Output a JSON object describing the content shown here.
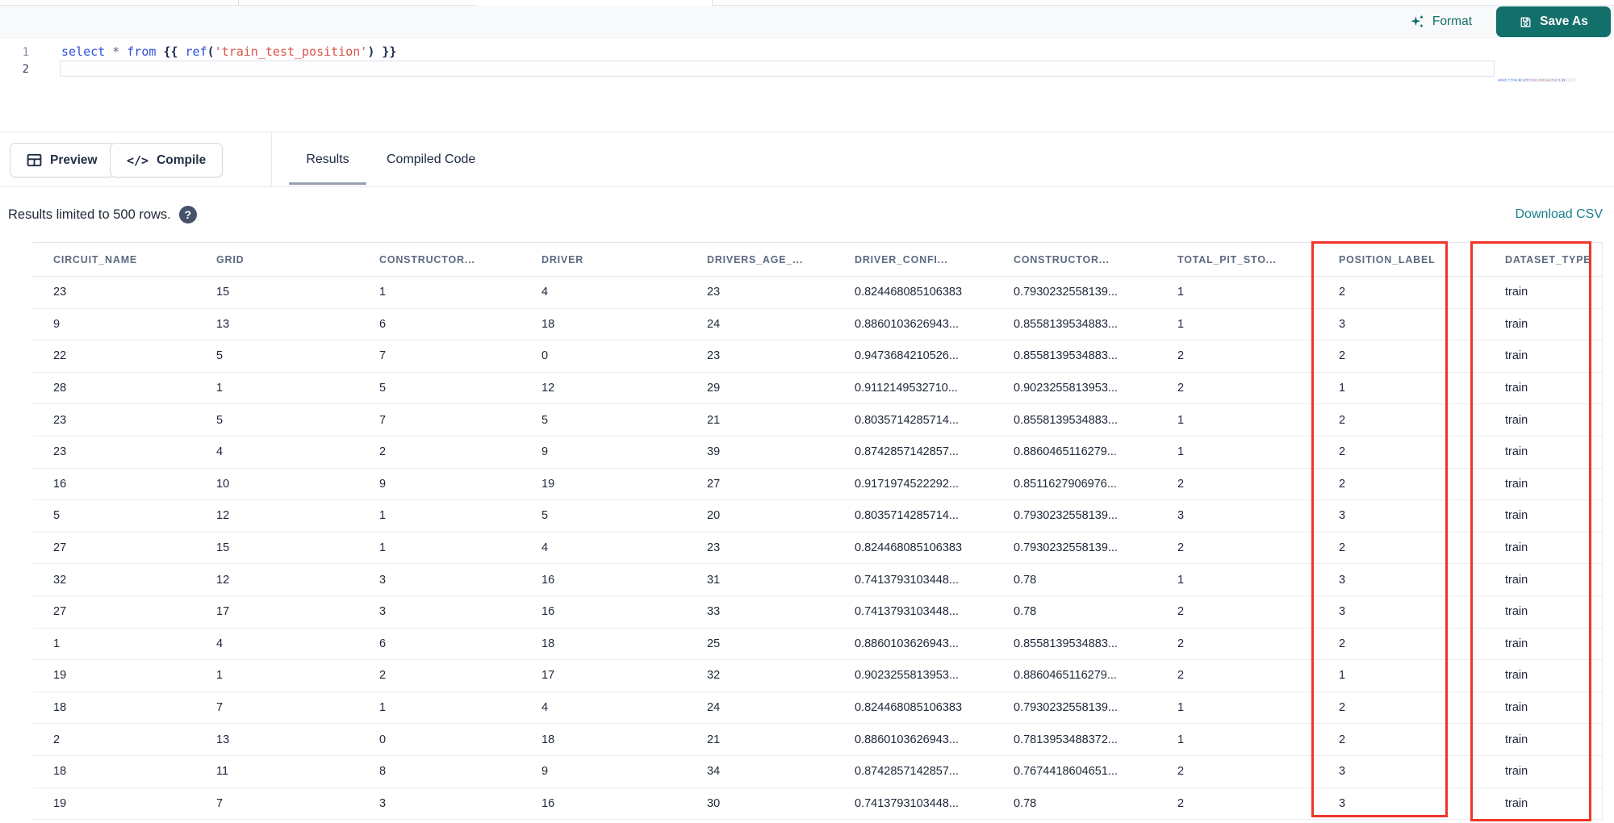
{
  "toolbar": {
    "format_label": "Format",
    "save_as_label": "Save As"
  },
  "editor": {
    "line_numbers": [
      "1",
      "2"
    ],
    "code_line_1": "select * from {{ ref('train_test_position') }}",
    "tokens": [
      {
        "t": "select",
        "c": "kw"
      },
      {
        "t": " ",
        "c": "pl"
      },
      {
        "t": "*",
        "c": "op"
      },
      {
        "t": " ",
        "c": "pl"
      },
      {
        "t": "from",
        "c": "kw"
      },
      {
        "t": " ",
        "c": "pl"
      },
      {
        "t": "{{ ",
        "c": "br"
      },
      {
        "t": "ref",
        "c": "kw"
      },
      {
        "t": "(",
        "c": "br"
      },
      {
        "t": "'train_test_position'",
        "c": "str"
      },
      {
        "t": ")",
        "c": "br"
      },
      {
        "t": " }}",
        "c": "br"
      }
    ]
  },
  "actions": {
    "preview_label": "Preview",
    "compile_label": "Compile",
    "compile_glyph": "</>"
  },
  "tabs": {
    "results": "Results",
    "compiled_code": "Compiled Code",
    "active": "Results"
  },
  "results": {
    "limit_notice": "Results limited to 500 rows.",
    "help_icon_glyph": "?",
    "download_label": "Download CSV"
  },
  "table": {
    "columns": [
      "CIRCUIT_NAME",
      "GRID",
      "CONSTRUCTOR...",
      "DRIVER",
      "DRIVERS_AGE_...",
      "DRIVER_CONFI...",
      "CONSTRUCTOR...",
      "TOTAL_PIT_STO...",
      "POSITION_LABEL",
      "DATASET_TYPE"
    ],
    "highlighted_columns": [
      "POSITION_LABEL",
      "DATASET_TYPE"
    ],
    "rows": [
      [
        "23",
        "15",
        "1",
        "4",
        "23",
        "0.824468085106383",
        "0.7930232558139...",
        "1",
        "2",
        "train"
      ],
      [
        "9",
        "13",
        "6",
        "18",
        "24",
        "0.8860103626943...",
        "0.8558139534883...",
        "1",
        "3",
        "train"
      ],
      [
        "22",
        "5",
        "7",
        "0",
        "23",
        "0.9473684210526...",
        "0.8558139534883...",
        "2",
        "2",
        "train"
      ],
      [
        "28",
        "1",
        "5",
        "12",
        "29",
        "0.9112149532710...",
        "0.9023255813953...",
        "2",
        "1",
        "train"
      ],
      [
        "23",
        "5",
        "7",
        "5",
        "21",
        "0.8035714285714...",
        "0.8558139534883...",
        "1",
        "2",
        "train"
      ],
      [
        "23",
        "4",
        "2",
        "9",
        "39",
        "0.8742857142857...",
        "0.8860465116279...",
        "1",
        "2",
        "train"
      ],
      [
        "16",
        "10",
        "9",
        "19",
        "27",
        "0.9171974522292...",
        "0.8511627906976...",
        "2",
        "2",
        "train"
      ],
      [
        "5",
        "12",
        "1",
        "5",
        "20",
        "0.8035714285714...",
        "0.7930232558139...",
        "3",
        "3",
        "train"
      ],
      [
        "27",
        "15",
        "1",
        "4",
        "23",
        "0.824468085106383",
        "0.7930232558139...",
        "2",
        "2",
        "train"
      ],
      [
        "32",
        "12",
        "3",
        "16",
        "31",
        "0.7413793103448...",
        "0.78",
        "1",
        "3",
        "train"
      ],
      [
        "27",
        "17",
        "3",
        "16",
        "33",
        "0.7413793103448...",
        "0.78",
        "2",
        "3",
        "train"
      ],
      [
        "1",
        "4",
        "6",
        "18",
        "25",
        "0.8860103626943...",
        "0.8558139534883...",
        "2",
        "2",
        "train"
      ],
      [
        "19",
        "1",
        "2",
        "17",
        "32",
        "0.9023255813953...",
        "0.8860465116279...",
        "2",
        "1",
        "train"
      ],
      [
        "18",
        "7",
        "1",
        "4",
        "24",
        "0.824468085106383",
        "0.7930232558139...",
        "1",
        "2",
        "train"
      ],
      [
        "2",
        "13",
        "0",
        "18",
        "21",
        "0.8860103626943...",
        "0.7813953488372...",
        "1",
        "2",
        "train"
      ],
      [
        "18",
        "11",
        "8",
        "9",
        "34",
        "0.8742857142857...",
        "0.7674418604651...",
        "2",
        "3",
        "train"
      ],
      [
        "19",
        "7",
        "3",
        "16",
        "30",
        "0.7413793103448...",
        "0.78",
        "2",
        "3",
        "train"
      ]
    ]
  },
  "colors": {
    "accent_teal": "#136f6a",
    "download_link": "#187f8c",
    "annotation_red": "#f1342a",
    "code_keyword": "#2d50d8",
    "code_string": "#d9534a",
    "code_brace": "#1c2b50",
    "code_operator": "#5b6b85"
  }
}
